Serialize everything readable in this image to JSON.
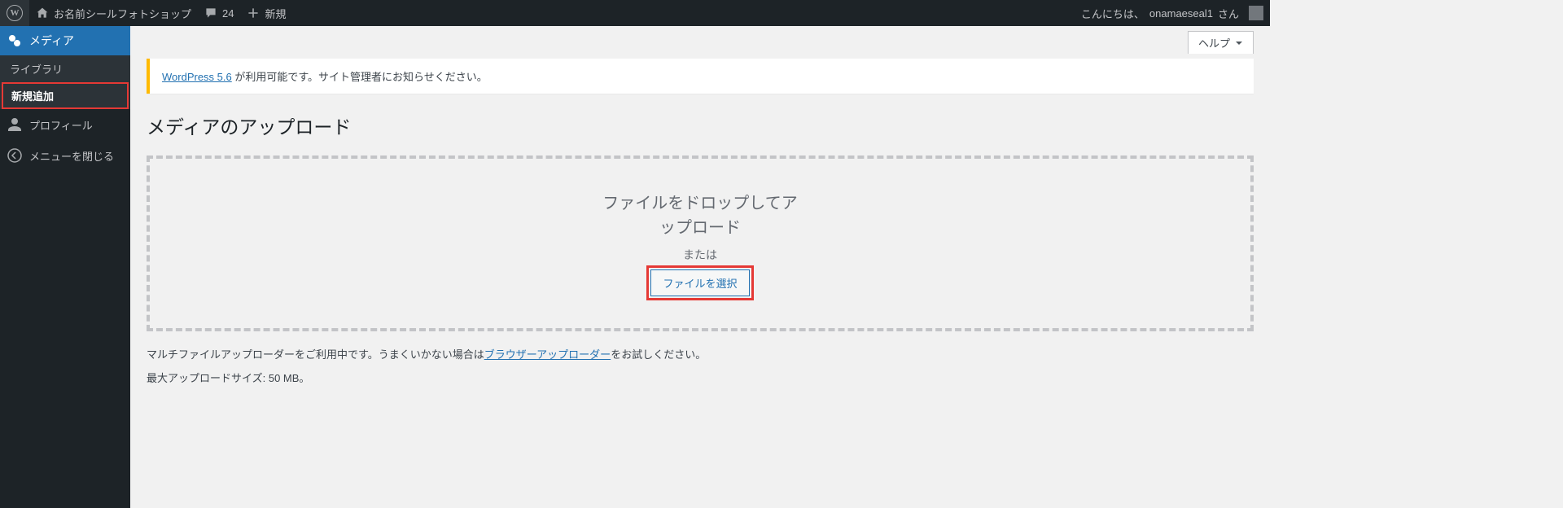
{
  "topbar": {
    "site_name": "お名前シールフォトショップ",
    "comments_count": "24",
    "new_label": "新規",
    "greeting_prefix": "こんにちは、",
    "user_name": "onamaeseal1",
    "greeting_suffix": " さん"
  },
  "sidebar": {
    "media": {
      "label": "メディア",
      "sub": {
        "library": "ライブラリ",
        "add_new": "新規追加"
      }
    },
    "profile": "プロフィール",
    "collapse": "メニューを閉じる"
  },
  "help": "ヘルプ",
  "notice": {
    "link": "WordPress 5.6",
    "tail": " が利用可能です。サイト管理者にお知らせください。"
  },
  "page_title": "メディアのアップロード",
  "drop": {
    "title": "ファイルをドロップしてアップロード",
    "or": "または",
    "button": "ファイルを選択"
  },
  "uploader_note": {
    "pre": "マルチファイルアップローダーをご利用中です。うまくいかない場合は",
    "link": "ブラウザーアップローダー",
    "post": "をお試しください。"
  },
  "max_size": "最大アップロードサイズ: 50 MB。"
}
